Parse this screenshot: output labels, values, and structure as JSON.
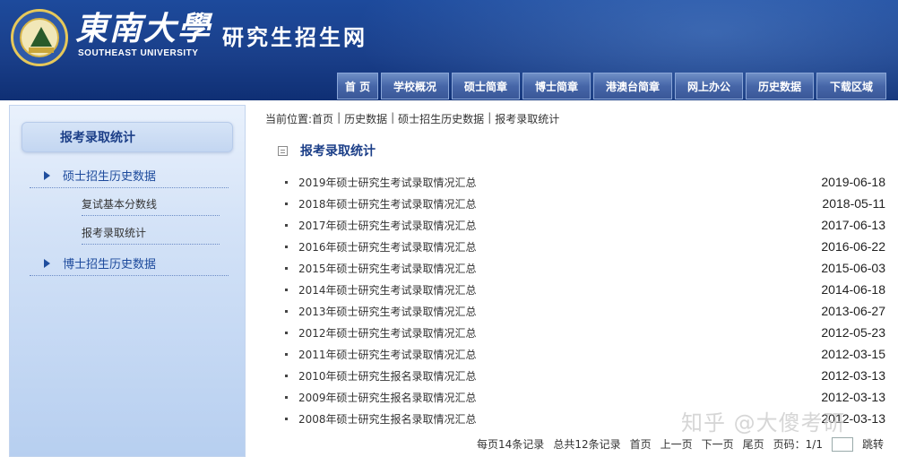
{
  "header": {
    "logo_cn": "東南大學",
    "logo_en": "SOUTHEAST UNIVERSITY",
    "site_title": "研究生招生网"
  },
  "nav": [
    "首 页",
    "学校概况",
    "硕士简章",
    "博士简章",
    "港澳台简章",
    "网上办公",
    "历史数据",
    "下载区域"
  ],
  "sidebar": {
    "title": "报考录取统计",
    "items": [
      {
        "label": "硕士招生历史数据"
      },
      {
        "label": "复试基本分数线"
      },
      {
        "label": "报考录取统计"
      },
      {
        "label": "博士招生历史数据"
      }
    ]
  },
  "breadcrumb": {
    "prefix": "当前位置:",
    "items": [
      "首页",
      "历史数据",
      "硕士招生历史数据",
      "报考录取统计"
    ],
    "sep": "|"
  },
  "section_title": "报考录取统计",
  "records": [
    {
      "title": "2019年硕士研究生考试录取情况汇总",
      "date": "2019-06-18"
    },
    {
      "title": "2018年硕士研究生考试录取情况汇总",
      "date": "2018-05-11"
    },
    {
      "title": "2017年硕士研究生考试录取情况汇总",
      "date": "2017-06-13"
    },
    {
      "title": "2016年硕士研究生考试录取情况汇总",
      "date": "2016-06-22"
    },
    {
      "title": "2015年硕士研究生考试录取情况汇总",
      "date": "2015-06-03"
    },
    {
      "title": "2014年硕士研究生考试录取情况汇总",
      "date": "2014-06-18"
    },
    {
      "title": "2013年硕士研究生考试录取情况汇总",
      "date": "2013-06-27"
    },
    {
      "title": "2012年硕士研究生考试录取情况汇总",
      "date": "2012-05-23"
    },
    {
      "title": "2011年硕士研究生考试录取情况汇总",
      "date": "2012-03-15"
    },
    {
      "title": "2010年硕士研究生报名录取情况汇总",
      "date": "2012-03-13"
    },
    {
      "title": "2009年硕士研究生报名录取情况汇总",
      "date": "2012-03-13"
    },
    {
      "title": "2008年硕士研究生报名录取情况汇总",
      "date": "2012-03-13"
    }
  ],
  "pager": {
    "per_page": "每页14条记录",
    "total": "总共12条记录",
    "first": "首页",
    "prev": "上一页",
    "next": "下一页",
    "last": "尾页",
    "page_info": "页码：1/1",
    "jump": "跳转"
  },
  "watermark": "知乎 @大傻考研",
  "colors": {
    "header_bg": "#1a3f8a",
    "nav_bg": "#4666a8",
    "sidebar_bg": "#d3e2f7",
    "accent": "#1c3f88"
  }
}
